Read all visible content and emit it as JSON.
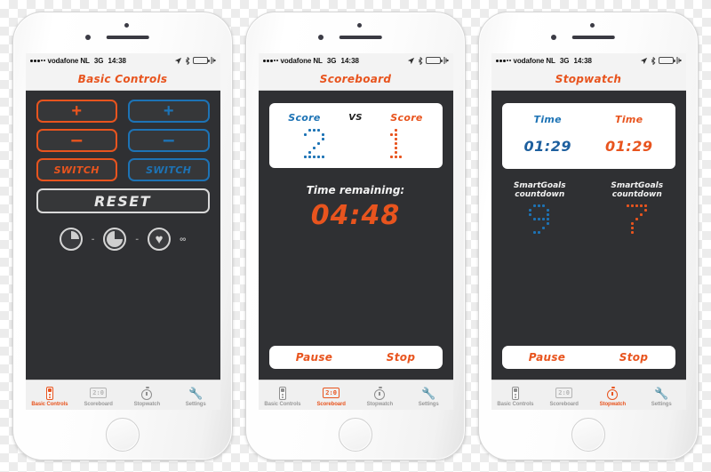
{
  "status_bar": {
    "carrier": "vodafone NL",
    "network": "3G",
    "time": "14:38",
    "signal_dots_filled": 3,
    "signal_dots_hollow": 2,
    "battery_level_pct": 66,
    "battery_color": "#5ac14a",
    "icons": [
      "location-arrow-icon",
      "bluetooth-icon",
      "battery-icon",
      "charging-plug-icon"
    ]
  },
  "theme": {
    "orange": "#e8541e",
    "blue": "#1d73b5",
    "screen_bg": "#2f3033",
    "card_bg": "#ffffff",
    "bar_bg": "#f3f3f3"
  },
  "tabs": [
    {
      "label": "Basic Controls",
      "icon": "remote-icon"
    },
    {
      "label": "Scoreboard",
      "icon": "score-icon",
      "icon_text": "2:0"
    },
    {
      "label": "Stopwatch",
      "icon": "stopwatch-icon"
    },
    {
      "label": "Settings",
      "icon": "tools-icon"
    }
  ],
  "phones": [
    {
      "title": "Basic Controls",
      "active_tab": 0,
      "controls": {
        "rows": [
          {
            "left_label": "+",
            "right_label": "+",
            "kind": "sign"
          },
          {
            "left_label": "–",
            "right_label": "–",
            "kind": "sign"
          },
          {
            "left_label": "SWITCH",
            "right_label": "SWITCH",
            "kind": "text"
          }
        ],
        "reset_label": "RESET",
        "dial_row": {
          "separator": "-",
          "infinity": "∞",
          "icons": [
            "clock-quarter-icon",
            "clock-three-quarter-icon",
            "heart-icon"
          ]
        }
      }
    },
    {
      "title": "Scoreboard",
      "active_tab": 1,
      "scoreboard": {
        "left_label": "Score",
        "vs_label": "VS",
        "right_label": "Score",
        "left_value": "2",
        "right_value": "1",
        "left_color": "#1d73b5",
        "right_color": "#e8541e"
      },
      "timer": {
        "caption": "Time remaining:",
        "value": "04:48"
      },
      "actions": {
        "pause": "Pause",
        "stop": "Stop"
      }
    },
    {
      "title": "Stopwatch",
      "active_tab": 2,
      "times": {
        "left_label": "Time",
        "right_label": "Time",
        "left_value": "01:29",
        "right_value": "01:29"
      },
      "smartgoals": {
        "left_caption": "SmartGoals countdown",
        "right_caption": "SmartGoals countdown",
        "left_value": "9",
        "right_value": "7",
        "left_color": "#1d73b5",
        "right_color": "#e8541e"
      },
      "actions": {
        "pause": "Pause",
        "stop": "Stop"
      }
    }
  ]
}
